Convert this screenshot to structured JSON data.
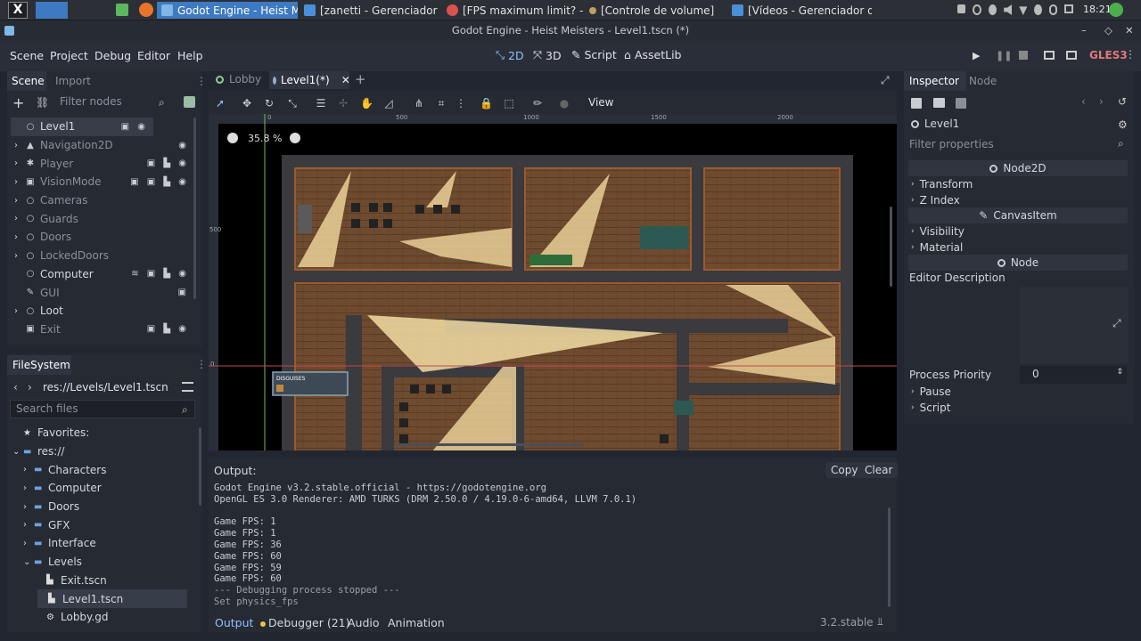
{
  "taskbar": {
    "tasks": [
      {
        "label": "Godot Engine - Heist M..."
      },
      {
        "label": "[zanetti - Gerenciador ..."
      },
      {
        "label": "[FPS maximum limit? - ..."
      },
      {
        "label": "[Controle de volume]"
      },
      {
        "label": "[Vídeos - Gerenciador d..."
      }
    ],
    "clock": "18:21"
  },
  "window_title": "Godot Engine - Heist Meisters - Level1.tscn (*)",
  "menu": {
    "items": [
      "Scene",
      "Project",
      "Debug",
      "Editor",
      "Help"
    ],
    "workspaces": [
      "2D",
      "3D",
      "Script",
      "AssetLib"
    ],
    "renderer": "GLES3"
  },
  "scene_dock": {
    "tabs": [
      "Scene",
      "Import"
    ],
    "filter_placeholder": "Filter nodes",
    "nodes": [
      {
        "name": "Level1"
      },
      {
        "name": "Navigation2D"
      },
      {
        "name": "Player"
      },
      {
        "name": "VisionMode"
      },
      {
        "name": "Cameras"
      },
      {
        "name": "Guards"
      },
      {
        "name": "Doors"
      },
      {
        "name": "LockedDoors"
      },
      {
        "name": "Computer"
      },
      {
        "name": "GUI"
      },
      {
        "name": "Loot"
      },
      {
        "name": "Exit"
      }
    ]
  },
  "filesystem": {
    "title": "FileSystem",
    "path": "res://Levels/Level1.tscn",
    "search_placeholder": "Search files",
    "items": [
      "Favorites:",
      "res://",
      "Characters",
      "Computer",
      "Doors",
      "GFX",
      "Interface",
      "Levels",
      "Exit.tscn",
      "Level1.tscn",
      "Lobby.gd"
    ]
  },
  "editor": {
    "tabs": [
      "Lobby",
      "Level1(*)"
    ],
    "zoom": "35.8 %",
    "view_label": "View",
    "ruler": [
      "0",
      "500",
      "1000",
      "1500",
      "2000"
    ],
    "vruler": [
      "500",
      "0"
    ],
    "hud_label": "DISGUISES"
  },
  "output": {
    "title": "Output:",
    "copy": "Copy",
    "clear": "Clear",
    "lines": [
      "Godot Engine v3.2.stable.official - https://godotengine.org",
      "OpenGL ES 3.0 Renderer: AMD TURKS (DRM 2.50.0 / 4.19.0-6-amd64, LLVM 7.0.1)",
      "",
      "Game FPS: 1",
      "Game FPS: 1",
      "Game FPS: 36",
      "Game FPS: 60",
      "Game FPS: 59",
      "Game FPS: 60",
      "--- Debugging process stopped ---",
      "Set physics_fps"
    ],
    "bottom_tabs": [
      "Output",
      "Debugger (21)",
      "Audio",
      "Animation"
    ],
    "version": "3.2.stable"
  },
  "inspector": {
    "tabs": [
      "Inspector",
      "Node"
    ],
    "node": "Level1",
    "filter_placeholder": "Filter properties",
    "sections": {
      "node2d": "Node2D",
      "transform": "Transform",
      "zindex": "Z Index",
      "canvasitem": "CanvasItem",
      "visibility": "Visibility",
      "material": "Material",
      "node": "Node",
      "editor_desc": "Editor Description",
      "process_priority": "Process Priority",
      "priority_value": "0",
      "pause": "Pause",
      "script": "Script"
    }
  }
}
